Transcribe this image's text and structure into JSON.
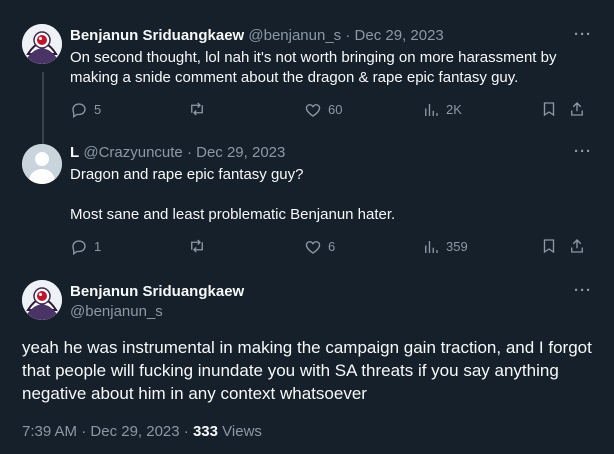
{
  "tweets": [
    {
      "name": "Benjanun Sriduangkaew",
      "handle": "@benjanun_s",
      "separator": "·",
      "date": "Dec 29, 2023",
      "text": "On second thought, lol nah it's not worth bringing on more harassment by making a snide comment about the dragon & rape epic fantasy guy.",
      "replies": "5",
      "retweets": "",
      "likes": "60",
      "views": "2K",
      "avatar_icon": "eye-avatar-icon"
    },
    {
      "name": "L",
      "handle": "@Crazyuncute",
      "separator": "·",
      "date": "Dec 29, 2023",
      "text": "Dragon and rape epic fantasy guy?\n\nMost sane and least problematic Benjanun hater.",
      "replies": "1",
      "retweets": "",
      "likes": "6",
      "views": "359",
      "avatar_icon": "default-person-avatar-icon"
    }
  ],
  "main": {
    "name": "Benjanun Sriduangkaew",
    "handle": "@benjanun_s",
    "text": "yeah he was instrumental in making the campaign gain traction, and I forgot that people will fucking inundate you with SA threats if you say anything negative about him in any context whatsoever",
    "time": "7:39 AM",
    "separator": "·",
    "date": "Dec 29, 2023",
    "separator2": "·",
    "views_count": "333",
    "views_label": "Views"
  },
  "more_label": "···",
  "colors": {
    "background": "#15202b",
    "text": "#f7f9f9",
    "muted": "#8b98a5",
    "thread_line": "#38444d",
    "avatar_eye": "#c0142d"
  }
}
